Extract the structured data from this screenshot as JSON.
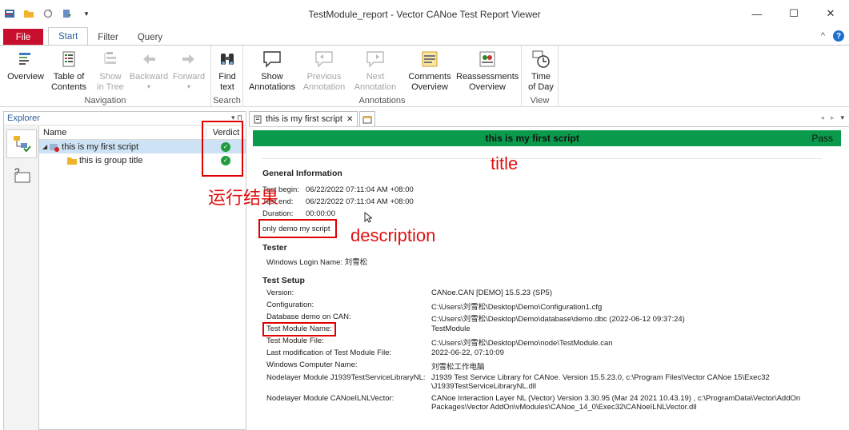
{
  "window": {
    "title": "TestModule_report - Vector CANoe Test Report Viewer",
    "minimize": "—",
    "maximize": "☐",
    "close": "✕"
  },
  "ribbon": {
    "tabs": [
      "File",
      "Start",
      "Filter",
      "Query"
    ],
    "collapse": "^",
    "help": "?",
    "groups": {
      "navigation": "Navigation",
      "search": "Search",
      "annotations": "Annotations",
      "view": "View"
    },
    "buttons": {
      "overview": "Overview",
      "toc_1": "Table of",
      "toc_2": "Contents",
      "show_1": "Show",
      "show_2": "in Tree",
      "backward": "Backward",
      "forward": "Forward",
      "find_1": "Find",
      "find_2": "text",
      "show_ann_1": "Show",
      "show_ann_2": "Annotations",
      "prev_ann_1": "Previous",
      "prev_ann_2": "Annotation",
      "next_ann_1": "Next",
      "next_ann_2": "Annotation",
      "comments_1": "Comments",
      "comments_2": "Overview",
      "reassess_1": "Reassessments",
      "reassess_2": "Overview",
      "time_1": "Time",
      "time_2": "of Day"
    }
  },
  "explorer": {
    "title": "Explorer",
    "pin": "▾ ⊓",
    "columns": {
      "name": "Name",
      "verdict": "Verdict"
    },
    "items": [
      {
        "label": "this is my first script"
      },
      {
        "label": "this is group title"
      }
    ]
  },
  "report": {
    "tab_label": "this is my first script",
    "tab_close": "✕",
    "banner_title": "this is my first script",
    "banner_status": "Pass",
    "general_title": "General Information",
    "general": [
      {
        "label": "Test begin:",
        "value": "06/22/2022 07:11:04 AM +08:00"
      },
      {
        "label": "Test end:",
        "value": "06/22/2022 07:11:04 AM +08:00"
      },
      {
        "label": "Duration:",
        "value": "00:00:00"
      }
    ],
    "description": "only demo my script",
    "tester_title": "Tester",
    "tester_line": "Windows Login Name:  刘雪松",
    "setup_title": "Test Setup",
    "setup": [
      {
        "label": "Version:",
        "value": "CANoe.CAN [DEMO] 15.5.23 (SP5)"
      },
      {
        "label": "Configuration:",
        "value": "C:\\Users\\刘雪松\\Desktop\\Demo\\Configuration1.cfg"
      },
      {
        "label": "Database demo on CAN:",
        "value": "C:\\Users\\刘雪松\\Desktop\\Demo\\database\\demo.dbc (2022-06-12 09:37:24)"
      },
      {
        "label": "Test Module Name:",
        "value": "TestModule"
      },
      {
        "label": "Test Module File:",
        "value": "C:\\Users\\刘雪松\\Desktop\\Demo\\node\\TestModule.can"
      },
      {
        "label": "Last modification of Test Module File:",
        "value": "2022-06-22, 07:10:09"
      },
      {
        "label": "Windows Computer Name:",
        "value": "刘雪松工作电脑"
      },
      {
        "label": "Nodelayer Module J1939TestServiceLibraryNL:",
        "value": "J1939 Test Service Library for CANoe. Version 15.5.23.0, c:\\Program Files\\Vector CANoe 15\\Exec32",
        "value2": "\\J1939TestServiceLibraryNL.dll"
      },
      {
        "label": "Nodelayer Module CANoeILNLVector:",
        "value": "CANoe Interaction Layer NL (Vector) Version 3.30.95 (Mar 24 2021 10.43.19) , c:\\ProgramData\\Vector\\AddOn",
        "value2": "Packages\\Vector AddOn\\vModules\\CANoe_14_0\\Exec32\\CANoeILNLVector.dll"
      }
    ]
  },
  "annotations": {
    "verdict": "运行结果",
    "title": "title",
    "description": "description"
  },
  "colors": {
    "pass_banner": "#0a9a4c",
    "file_tab": "#c8102e",
    "annotation_red": "#e00000"
  }
}
